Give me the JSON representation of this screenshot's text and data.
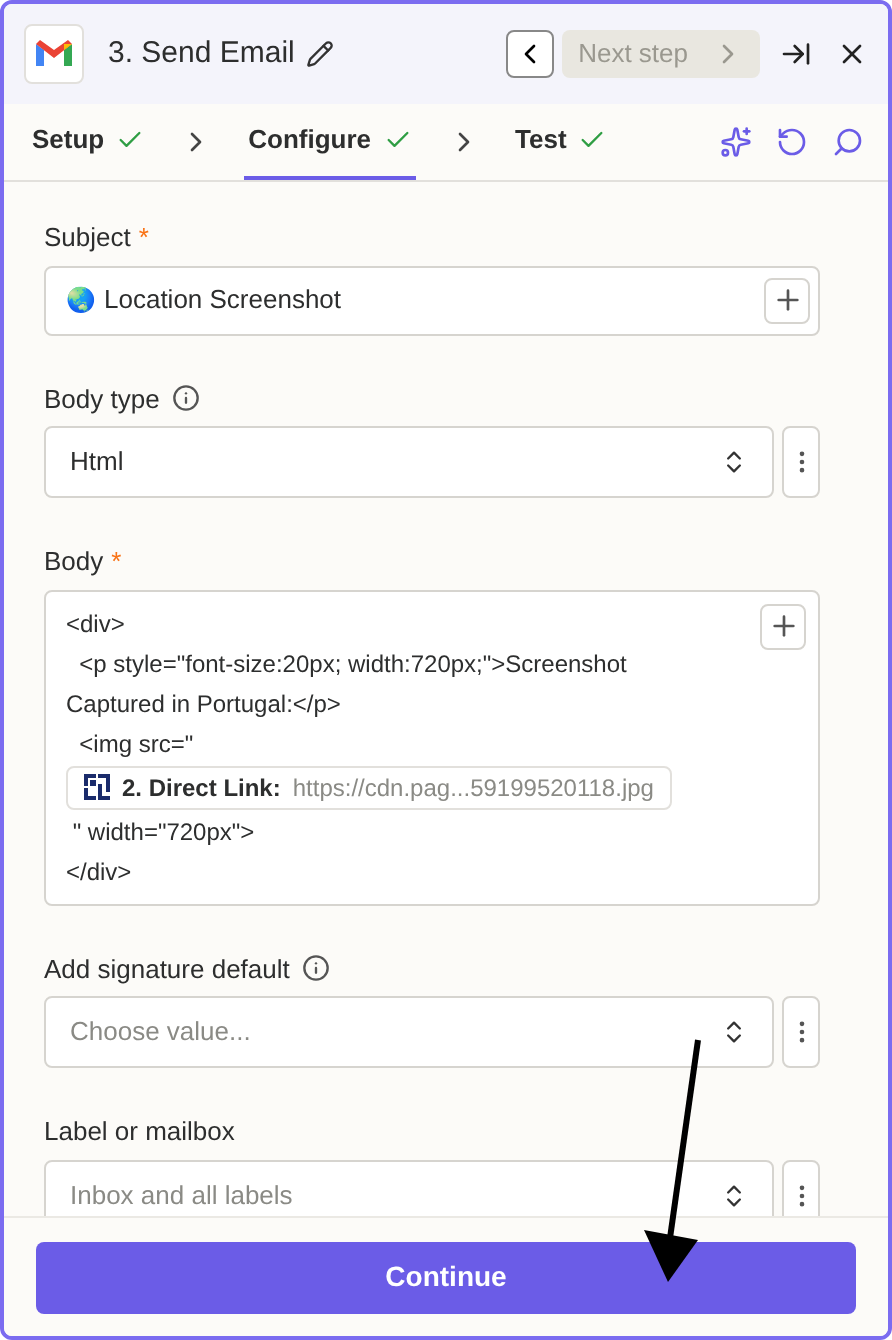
{
  "header": {
    "title": "3. Send Email",
    "next_step": "Next step"
  },
  "steps": [
    {
      "label": "Setup",
      "selected": false,
      "done": true
    },
    {
      "label": "Configure",
      "selected": true,
      "done": true
    },
    {
      "label": "Test",
      "selected": false,
      "done": true
    }
  ],
  "required_mark": "*",
  "fields": [
    {
      "kind": "text",
      "label": "Subject",
      "required": true,
      "info": false,
      "icon": "🌏",
      "value": "Location Screenshot"
    },
    {
      "kind": "select",
      "label": "Body type",
      "required": false,
      "info": true,
      "value": "Html"
    },
    {
      "kind": "code",
      "label": "Body",
      "required": true,
      "info": false,
      "lines": [
        {
          "kind": "text",
          "text": "<div>"
        },
        {
          "kind": "text",
          "text": "  <p style=\"font-size:20px; width:720px;\">Screenshot"
        },
        {
          "kind": "text",
          "text": "Captured in Portugal:</p>"
        },
        {
          "kind": "text",
          "text": "  <img src=\""
        },
        {
          "kind": "token",
          "label": "2. Direct Link:",
          "value": "https://cdn.pag...59199520118.jpg"
        },
        {
          "kind": "text",
          "text": " \" width=\"720px\">"
        },
        {
          "kind": "text",
          "text": "</div>"
        }
      ]
    },
    {
      "kind": "select",
      "label": "Add signature default",
      "required": false,
      "info": true,
      "placeholder": "Choose value..."
    },
    {
      "kind": "select",
      "label": "Label or mailbox",
      "required": false,
      "info": false,
      "placeholder": "Inbox and all labels"
    }
  ],
  "continue": "Continue"
}
